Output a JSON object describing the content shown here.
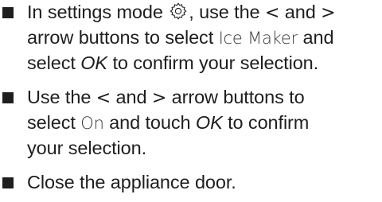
{
  "steps": [
    {
      "line1": {
        "t1": "In settings mode",
        "icon": "gear-icon",
        "t2": ", use the",
        "lt": "<",
        "t3": "and",
        "gt": ">"
      },
      "line2": {
        "t1": "arrow buttons to select",
        "ui": "Ice Maker",
        "t2": "and"
      },
      "line3": {
        "t1": "select",
        "em": "OK",
        "t2": "to confirm your selection."
      }
    },
    {
      "line1": {
        "t1": "Use the",
        "lt": "<",
        "t2": "and",
        "gt": ">",
        "t3": "arrow buttons to"
      },
      "line2": {
        "t1": "select",
        "ui": "On",
        "t2": "and touch",
        "em": "OK",
        "t3": "to confirm"
      },
      "line3": {
        "t1": "your selection."
      }
    },
    {
      "line1": {
        "t1": "Close the appliance door."
      }
    }
  ]
}
